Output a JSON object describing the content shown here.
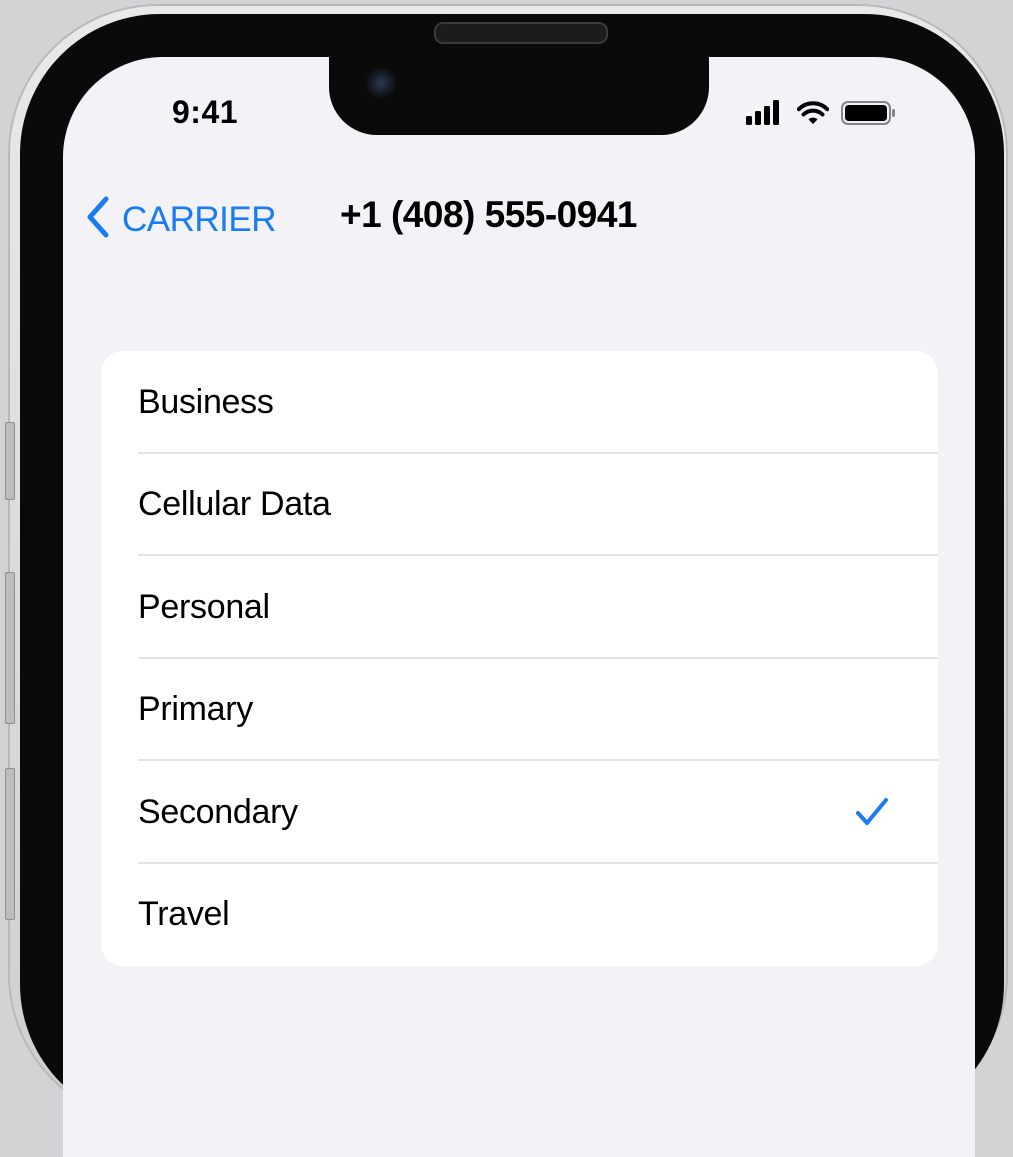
{
  "status_bar": {
    "time": "9:41",
    "icons": [
      "cellular-signal-icon",
      "wifi-icon",
      "battery-icon"
    ]
  },
  "nav": {
    "back_label": "CARRIER",
    "back_icon": "chevron-left-icon",
    "title": "+1 (408) 555-0941"
  },
  "label_options": [
    {
      "label": "Business",
      "selected": false
    },
    {
      "label": "Cellular Data",
      "selected": false
    },
    {
      "label": "Personal",
      "selected": false
    },
    {
      "label": "Primary",
      "selected": false
    },
    {
      "label": "Secondary",
      "selected": true
    },
    {
      "label": "Travel",
      "selected": false
    }
  ],
  "colors": {
    "accent": "#1a7cf5",
    "background": "#f2f2f7",
    "card": "#ffffff",
    "text": "#000000"
  }
}
